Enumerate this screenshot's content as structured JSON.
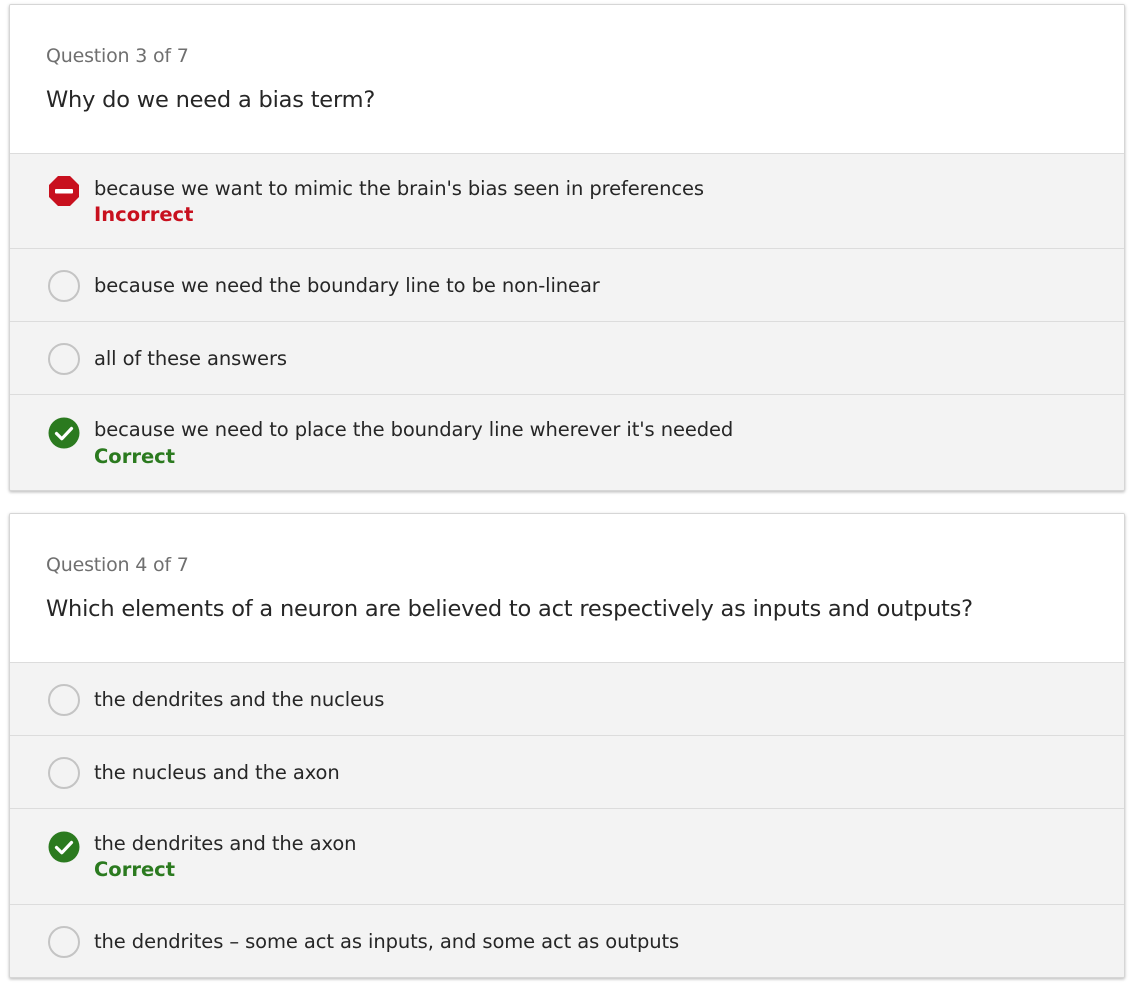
{
  "colors": {
    "incorrect": "#c8101e",
    "correct": "#2b7a1f",
    "option_background": "#f3f3f3",
    "radio_border": "#c4c4c4"
  },
  "questions": [
    {
      "counter": "Question 3 of 7",
      "text": "Why do we need a bias term?",
      "options": [
        {
          "label": "because we want to mimic the brain's bias seen in preferences",
          "state": "incorrect",
          "icon": "stop-minus-icon",
          "feedback": "Incorrect"
        },
        {
          "label": "because we need the boundary line to be non-linear",
          "state": "unselected",
          "icon": "radio-empty-icon"
        },
        {
          "label": "all of these answers",
          "state": "unselected",
          "icon": "radio-empty-icon"
        },
        {
          "label": "because we need to place the boundary line wherever it's needed",
          "state": "correct",
          "icon": "check-circle-icon",
          "feedback": "Correct"
        }
      ]
    },
    {
      "counter": "Question 4 of 7",
      "text": "Which elements of a neuron are believed to act respectively as inputs and outputs?",
      "options": [
        {
          "label": "the dendrites and the nucleus",
          "state": "unselected",
          "icon": "radio-empty-icon"
        },
        {
          "label": "the nucleus and the axon",
          "state": "unselected",
          "icon": "radio-empty-icon"
        },
        {
          "label": "the dendrites and the axon",
          "state": "correct",
          "icon": "check-circle-icon",
          "feedback": "Correct"
        },
        {
          "label": "the dendrites – some act as inputs, and some act as outputs",
          "state": "unselected",
          "icon": "radio-empty-icon"
        }
      ]
    }
  ]
}
